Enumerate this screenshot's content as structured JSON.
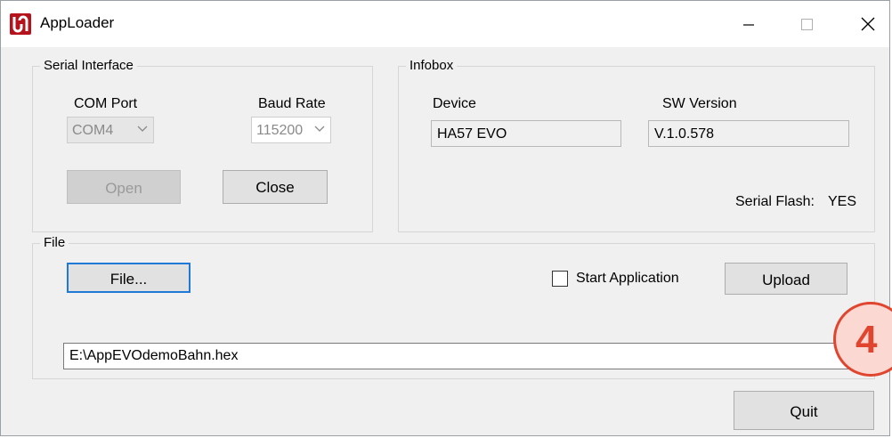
{
  "window": {
    "title": "AppLoader"
  },
  "serial_interface": {
    "group_label": "Serial Interface",
    "com_port_label": "COM Port",
    "com_port_value": "COM4",
    "baud_rate_label": "Baud Rate",
    "baud_rate_value": "115200",
    "open_label": "Open",
    "close_label": "Close"
  },
  "infobox": {
    "group_label": "Infobox",
    "device_label": "Device",
    "device_value": "HA57 EVO",
    "sw_version_label": "SW Version",
    "sw_version_value": "V.1.0.578",
    "serial_flash_label": "Serial Flash:",
    "serial_flash_value": "YES"
  },
  "file": {
    "group_label": "File",
    "file_button_label": "File...",
    "start_application_label": "Start Application",
    "start_application_checked": false,
    "upload_label": "Upload",
    "path_value": "E:\\AppEVOdemoBahn.hex"
  },
  "quit_label": "Quit",
  "annotation_badge": "4",
  "colors": {
    "accent_focus": "#1f79d6",
    "badge_red": "#e0462f",
    "badge_fill": "#fbd9d2",
    "app_icon_red": "#b5121b"
  }
}
